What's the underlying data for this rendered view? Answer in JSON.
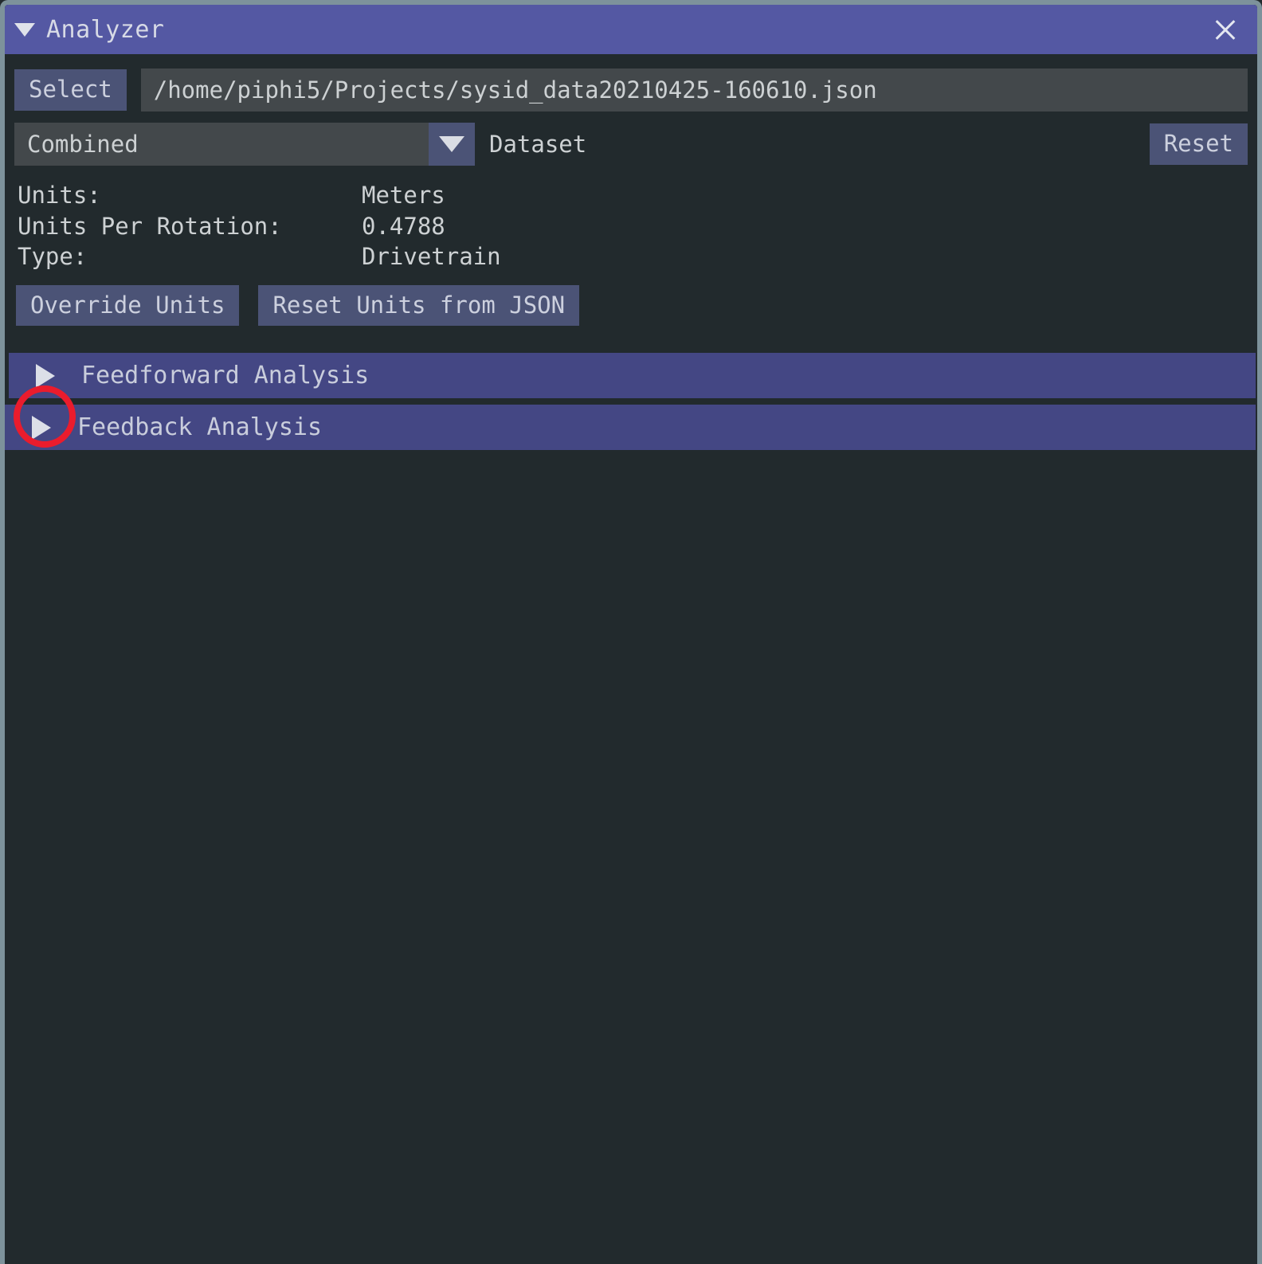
{
  "window": {
    "title": "Analyzer",
    "collapse_icon": "triangle-down-icon",
    "close_icon": "close-icon"
  },
  "file_row": {
    "select_label": "Select",
    "path_value": "/home/piphi5/Projects/sysid_data20210425-160610.json"
  },
  "dataset_row": {
    "selected": "Combined",
    "dropdown_icon": "triangle-down-icon",
    "label": "Dataset",
    "reset_label": "Reset"
  },
  "units": {
    "lines": [
      {
        "key": "Units:",
        "value": "Meters"
      },
      {
        "key": "Units Per Rotation:",
        "value": "0.4788"
      },
      {
        "key": "Type:",
        "value": "Drivetrain"
      }
    ],
    "override_label": "Override Units",
    "reset_from_json_label": "Reset Units from JSON"
  },
  "sections": [
    {
      "label": "Feedforward Analysis",
      "icon": "triangle-right-icon",
      "expanded": false
    },
    {
      "label": "Feedback Analysis",
      "icon": "triangle-right-icon",
      "expanded": false
    }
  ],
  "annotation": {
    "shape": "circle",
    "color": "#ea1c2d",
    "target": "feedback-analysis-expand-arrow"
  },
  "colors": {
    "title_bar": "#5458a3",
    "section_header": "#444784",
    "button": "#4b5376",
    "field": "#43484b",
    "background": "#222a2d",
    "window_border": "#7d929b",
    "text": "#cdd1d3",
    "annotation": "#ea1c2d"
  }
}
